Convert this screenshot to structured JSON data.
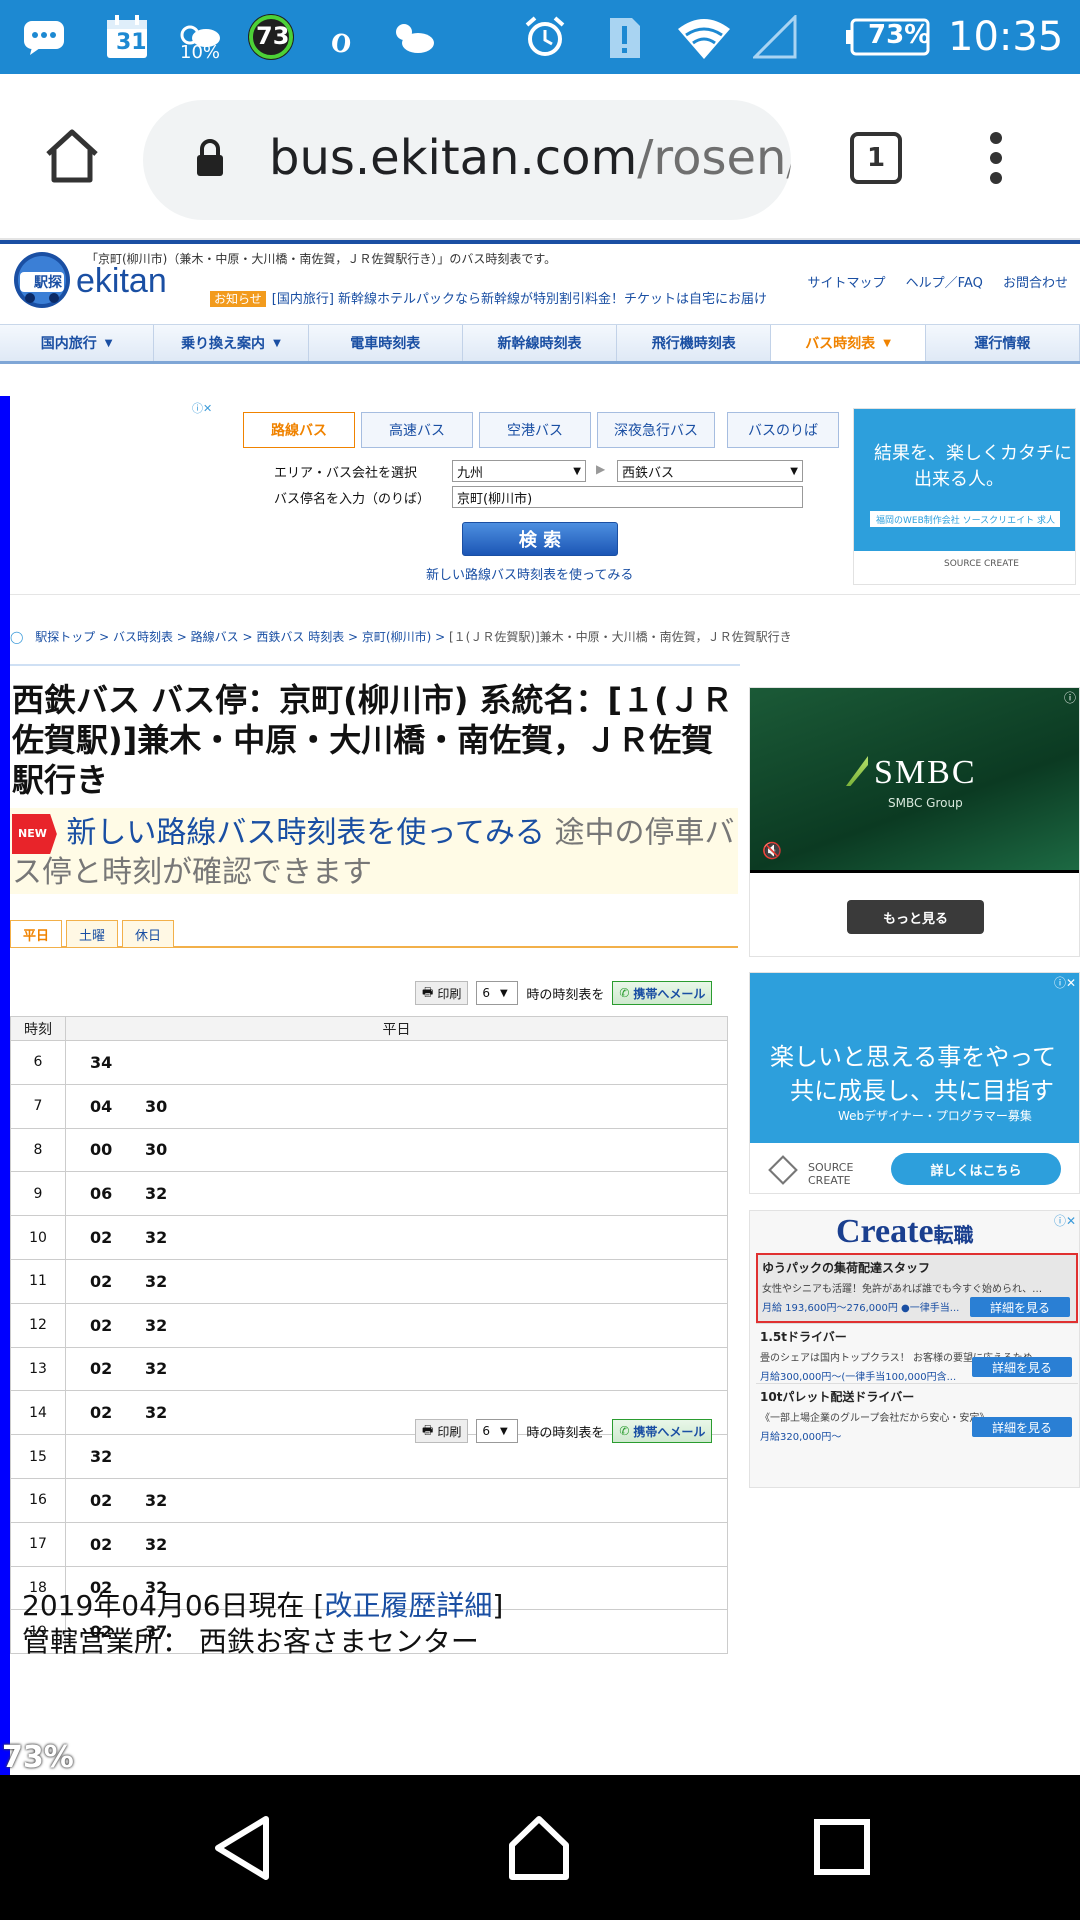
{
  "statusbar": {
    "calendar_day": "31",
    "weather_pct": "10%",
    "circle_num": "73",
    "battery": "73%",
    "time": "10:35"
  },
  "browser": {
    "url_host": "bus.ekitan.com",
    "url_path": "/rosen/l",
    "tab_count": "1"
  },
  "header": {
    "logo_text": "ekitan",
    "logo_kanji": "駅探",
    "intro": "「京町(柳川市)（兼木・中原・大川橋・南佐賀，ＪＲ佐賀駅行き）」のバス時刻表です。",
    "links": [
      "サイトマップ",
      "ヘルプ／FAQ",
      "お問合わせ"
    ],
    "notice_badge": "お知らせ",
    "notice": "[国内旅行] 新幹線ホテルパックなら新幹線が特別割引料金！チケットは自宅にお届け"
  },
  "gnav": [
    {
      "label": "国内旅行",
      "arrow": true
    },
    {
      "label": "乗り換え案内",
      "arrow": true
    },
    {
      "label": "電車時刻表",
      "arrow": false
    },
    {
      "label": "新幹線時刻表",
      "arrow": false
    },
    {
      "label": "飛行機時刻表",
      "arrow": false
    },
    {
      "label": "バス時刻表",
      "arrow": true,
      "active": true
    },
    {
      "label": "運行情報",
      "arrow": false
    }
  ],
  "search": {
    "tabs": [
      "路線バス",
      "高速バス",
      "空港バス",
      "深夜急行バス",
      "バスのりば"
    ],
    "area_label": "エリア・バス会社を選択",
    "area_value": "九州",
    "company_value": "西鉄バス",
    "stop_label": "バス停名を入力（のりば）",
    "stop_value": "京町(柳川市)",
    "search_button": "検 索",
    "new_link": "新しい路線バス時刻表を使ってみる"
  },
  "ad_right1": {
    "line1": "結果を、楽しくカタチに",
    "line2": "出来る人。",
    "bar": "福岡のWEB制作会社 ソースクリエイト 求人",
    "brand": "SOURCE CREATE"
  },
  "breadcrumb": [
    "駅探トップ",
    "バス時刻表",
    "路線バス",
    "西鉄バス 時刻表",
    "京町(柳川市)",
    "[１(ＪＲ佐賀駅)]兼木・中原・大川橋・南佐賀，ＪＲ佐賀駅行き"
  ],
  "page_title": "西鉄バス  バス停：京町(柳川市)  系統名：[１(ＪＲ佐賀駅)]兼木・中原・大川橋・南佐賀，ＪＲ佐賀駅行き",
  "new_banner": {
    "badge": "NEW",
    "link": "新しい路線バス時刻表を使ってみる",
    "text": " 途中の停車バス停と時刻が確認できます"
  },
  "day_tabs": [
    "平日",
    "土曜",
    "休日"
  ],
  "tools": {
    "print": "印刷",
    "hour": "6",
    "suffix": "時の時刻表を",
    "mail": "携帯へメール"
  },
  "timetable": {
    "col_hour": "時刻",
    "col_day": "平日",
    "rows": [
      {
        "hour": "6",
        "mins": [
          "34"
        ]
      },
      {
        "hour": "7",
        "mins": [
          "04",
          "30"
        ]
      },
      {
        "hour": "8",
        "mins": [
          "00",
          "30"
        ]
      },
      {
        "hour": "9",
        "mins": [
          "06",
          "32"
        ]
      },
      {
        "hour": "10",
        "mins": [
          "02",
          "32"
        ]
      },
      {
        "hour": "11",
        "mins": [
          "02",
          "32"
        ]
      },
      {
        "hour": "12",
        "mins": [
          "02",
          "32"
        ]
      },
      {
        "hour": "13",
        "mins": [
          "02",
          "32"
        ]
      },
      {
        "hour": "14",
        "mins": [
          "02",
          "32"
        ]
      },
      {
        "hour": "15",
        "mins": [
          "32"
        ]
      },
      {
        "hour": "16",
        "mins": [
          "02",
          "32"
        ]
      },
      {
        "hour": "17",
        "mins": [
          "02",
          "32"
        ]
      },
      {
        "hour": "18",
        "mins": [
          "02",
          "32"
        ]
      },
      {
        "hour": "19",
        "mins": [
          "02",
          "37"
        ]
      }
    ]
  },
  "footer": {
    "date": "2019年04月06日現在 [",
    "link": "改正履歴詳細",
    "close": "]",
    "office": "管轄営業所：  西鉄お客さまセンター"
  },
  "overlay_pct": "73%",
  "ad_smbc": {
    "brand": "SMBC",
    "sub": "SMBC Group",
    "more": "もっと見る"
  },
  "ad_source": {
    "line1": "楽しいと思える事をやって",
    "line2": "共に成長し、共に目指す",
    "line3": "Webデザイナー・プログラマー募集",
    "brand": "SOURCE CREATE",
    "cta": "詳しくはこちら"
  },
  "ad_jobs": {
    "logo": "Create",
    "logo_sub": "転職",
    "jobs": [
      {
        "title": "ゆうパックの集荷配達スタッフ",
        "desc": "女性やシニアも活躍！免許があれば誰でも今すぐ始められ、…",
        "pay": "月給 193,600円〜276,000円 ●一律手当...",
        "btn": "詳細を見る"
      },
      {
        "title": "1.5tドライバー",
        "desc": "畳のシェアは国内トップクラス！ お客様の要望に応えるため…",
        "pay": "月給300,000円〜(一律手当100,000円含...",
        "btn": "詳細を見る"
      },
      {
        "title": "10tパレット配送ドライバー",
        "desc": "《一部上場企業のグループ会社だから安心・安定》",
        "pay": "月給320,000円〜",
        "btn": "詳細を見る"
      }
    ]
  },
  "colors": {
    "statusbar": "#1d89d2",
    "accent_orange": "#f08300",
    "link_blue": "#1a4fa3"
  }
}
